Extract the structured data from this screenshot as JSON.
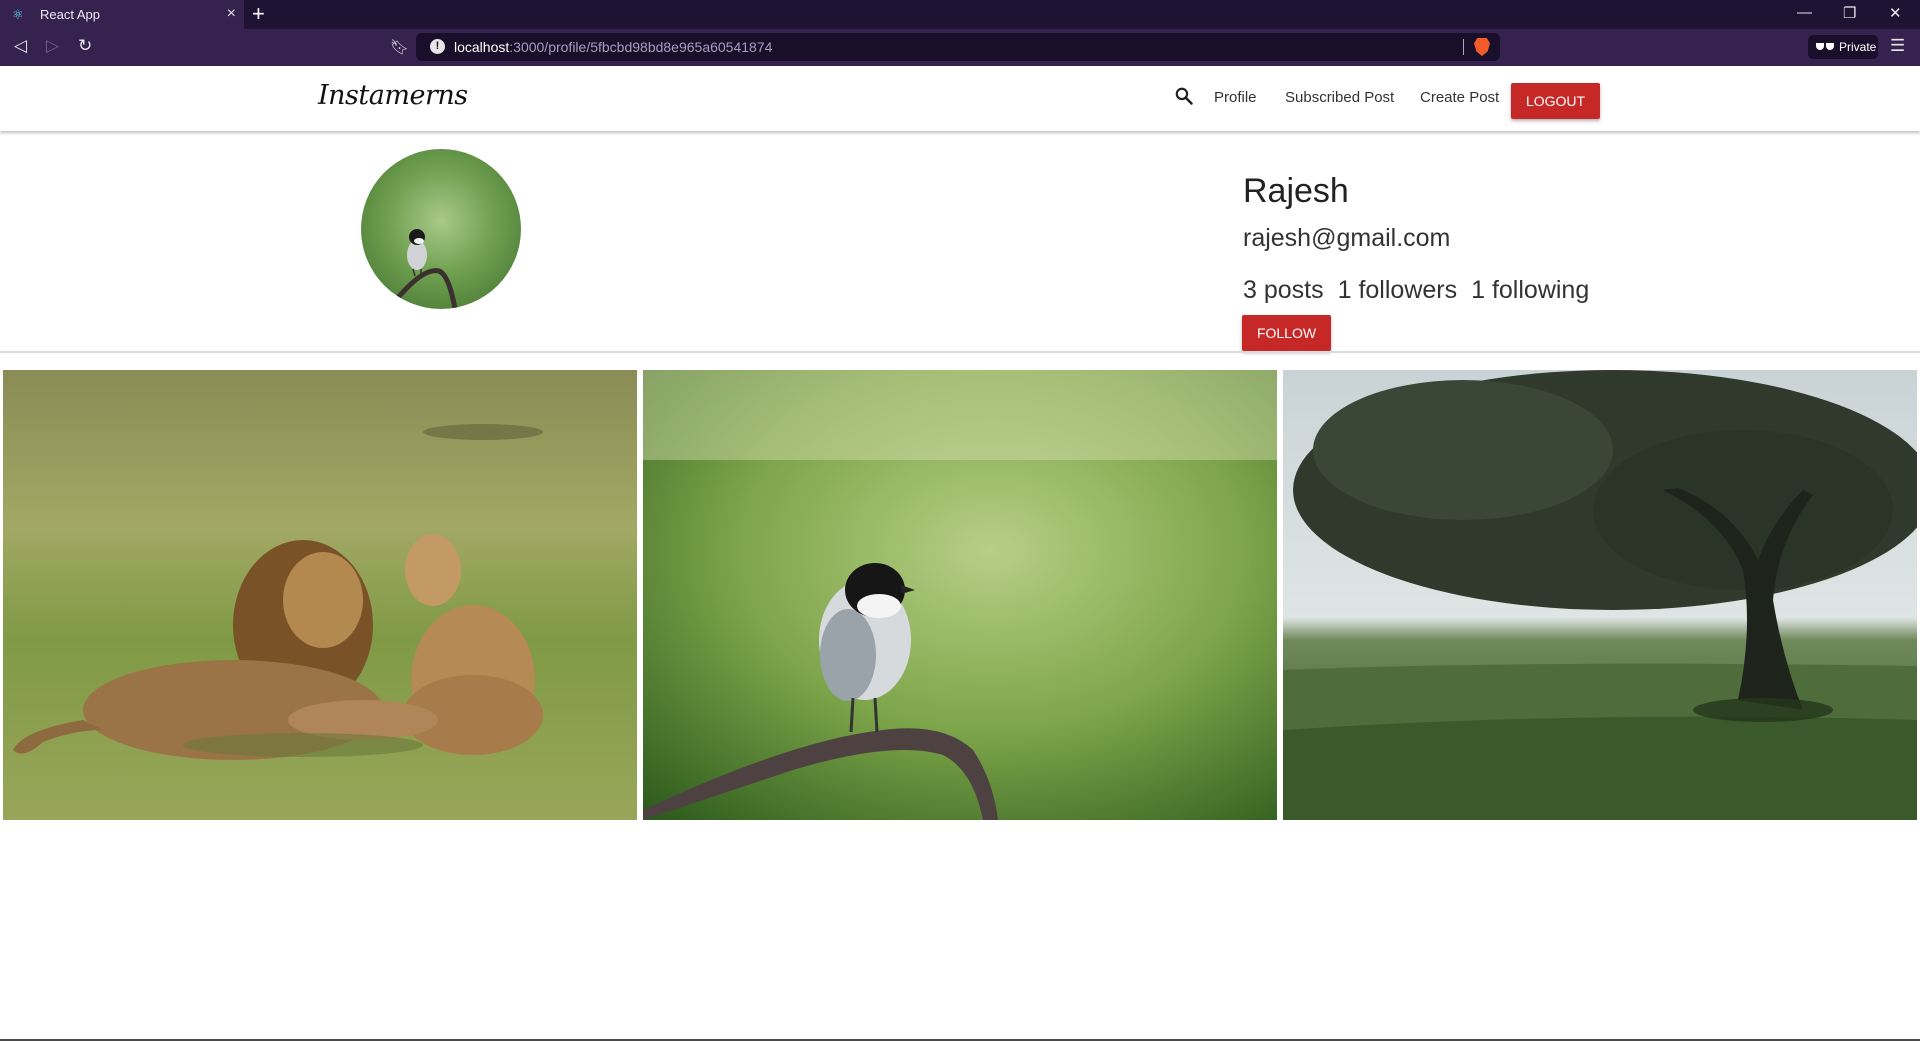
{
  "browser": {
    "tab_title": "React App",
    "url_host": "localhost",
    "url_path": ":3000/profile/5fbcbd98bd8e965a60541874",
    "private_label": "Private"
  },
  "nav": {
    "brand": "Instamerns",
    "links": [
      "Profile",
      "Subscribed Post",
      "Create Post"
    ],
    "logout": "LOGOUT"
  },
  "profile": {
    "name": "Rajesh",
    "email": "rajesh@gmail.com",
    "posts": "3 posts",
    "followers": "1 followers",
    "following": "1 following",
    "follow_button": "FOLLOW"
  },
  "posts": [
    {
      "subject": "lions"
    },
    {
      "subject": "bird"
    },
    {
      "subject": "tree"
    }
  ],
  "colors": {
    "accent": "#c62828",
    "chrome": "#35224f",
    "chrome_dark": "#1f1334"
  }
}
